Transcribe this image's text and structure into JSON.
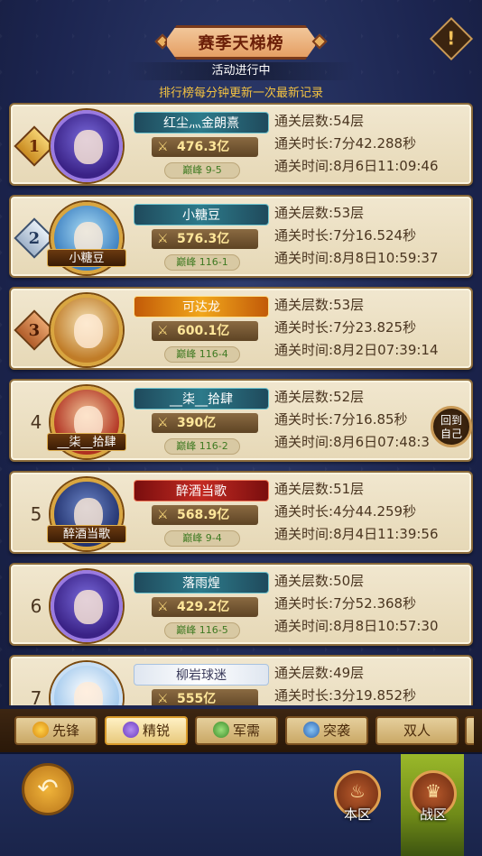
{
  "header": {
    "title": "赛季天梯榜",
    "status": "活动进行中",
    "update_note": "排行榜每分钟更新一次最新记录",
    "warn_symbol": "!"
  },
  "stat_labels": {
    "layers": "通关层数:",
    "duration": "通关时长:",
    "time": "通关时间:"
  },
  "entries": [
    {
      "rank": "1",
      "name": "红尘灬金朗熹",
      "avatar_name": "",
      "power": "476.3亿",
      "tier": "巅峰 9-5",
      "layers": "54层",
      "duration": "7分42.288秒",
      "time": "8月6日11:09:46"
    },
    {
      "rank": "2",
      "name": "小糖豆",
      "avatar_name": "小糖豆",
      "power": "576.3亿",
      "tier": "巅峰 116-1",
      "layers": "53层",
      "duration": "7分16.524秒",
      "time": "8月8日10:59:37"
    },
    {
      "rank": "3",
      "name": "可达龙",
      "avatar_name": "",
      "power": "600.1亿",
      "tier": "巅峰 116-4",
      "layers": "53层",
      "duration": "7分23.825秒",
      "time": "8月2日07:39:14"
    },
    {
      "rank": "4",
      "name": "__柒__拾肆",
      "avatar_name": "__柒__拾肆",
      "power": "390亿",
      "tier": "巅峰 116-2",
      "layers": "52层",
      "duration": "7分16.85秒",
      "time": "8月6日07:48:3"
    },
    {
      "rank": "5",
      "name": "醉酒当歌",
      "avatar_name": "醉酒当歌",
      "power": "568.9亿",
      "tier": "巅峰 9-4",
      "layers": "51层",
      "duration": "4分44.259秒",
      "time": "8月4日11:39:56"
    },
    {
      "rank": "6",
      "name": "落雨煌",
      "avatar_name": "",
      "power": "429.2亿",
      "tier": "巅峰 116-5",
      "layers": "50层",
      "duration": "7分52.368秒",
      "time": "8月8日10:57:30"
    },
    {
      "rank": "7",
      "name": "柳岩球迷",
      "avatar_name": "",
      "power": "555亿",
      "tier": "",
      "layers": "49层",
      "duration": "3分19.852秒",
      "time": ""
    }
  ],
  "goto_self": {
    "line1": "回到",
    "line2": "自己"
  },
  "tabs": [
    {
      "label": "先锋",
      "icon": "shield-icon"
    },
    {
      "label": "精锐",
      "icon": "spiral-icon"
    },
    {
      "label": "军需",
      "icon": "leaf-icon"
    },
    {
      "label": "突袭",
      "icon": "swirl-icon"
    },
    {
      "label": "双人",
      "icon": ""
    }
  ],
  "bottom": {
    "back_symbol": "↶",
    "local_zone": "本区",
    "battle_zone": "战区"
  },
  "colors": {
    "accent_gold": "#f3c241",
    "card_bg": "#efe4c9",
    "tier_green": "#3f7a22",
    "active_zone": "#9ab82a"
  }
}
